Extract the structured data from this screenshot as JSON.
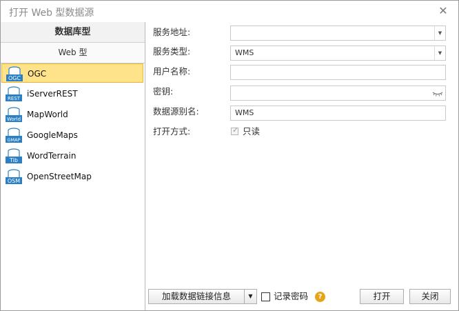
{
  "window": {
    "title": "打开 Web 型数据源"
  },
  "left_panel": {
    "header": "数据库型",
    "subheader": "Web 型",
    "items": [
      {
        "label": "OGC",
        "icon": "ogc-icon",
        "badge": "OGC",
        "selected": true
      },
      {
        "label": "iServerREST",
        "icon": "rest-icon",
        "badge": "REST",
        "selected": false
      },
      {
        "label": "MapWorld",
        "icon": "world-icon",
        "badge": "World",
        "selected": false
      },
      {
        "label": "GoogleMaps",
        "icon": "gmap-icon",
        "badge": "GMAP",
        "selected": false
      },
      {
        "label": "WordTerrain",
        "icon": "tib-icon",
        "badge": "Tib",
        "selected": false
      },
      {
        "label": "OpenStreetMap",
        "icon": "osm-icon",
        "badge": "OSM",
        "selected": false
      }
    ]
  },
  "form": {
    "service_url": {
      "label": "服务地址:",
      "value": ""
    },
    "service_type": {
      "label": "服务类型:",
      "value": "WMS"
    },
    "username": {
      "label": "用户名称:",
      "value": ""
    },
    "password": {
      "label": "密钥:",
      "value": ""
    },
    "alias": {
      "label": "数据源别名:",
      "value": "WMS"
    },
    "open_mode": {
      "label": "打开方式:",
      "readonly_label": "只读",
      "readonly_checked": true
    }
  },
  "footer": {
    "load_button": "加载数据链接信息",
    "remember_label": "记录密码",
    "remember_checked": false,
    "help": "?",
    "open_button": "打开",
    "close_button": "关闭"
  },
  "colors": {
    "selected_bg": "#ffe38a",
    "selected_border": "#e8b733",
    "icon_blue": "#2b7fc4",
    "help_orange": "#e8a317"
  }
}
